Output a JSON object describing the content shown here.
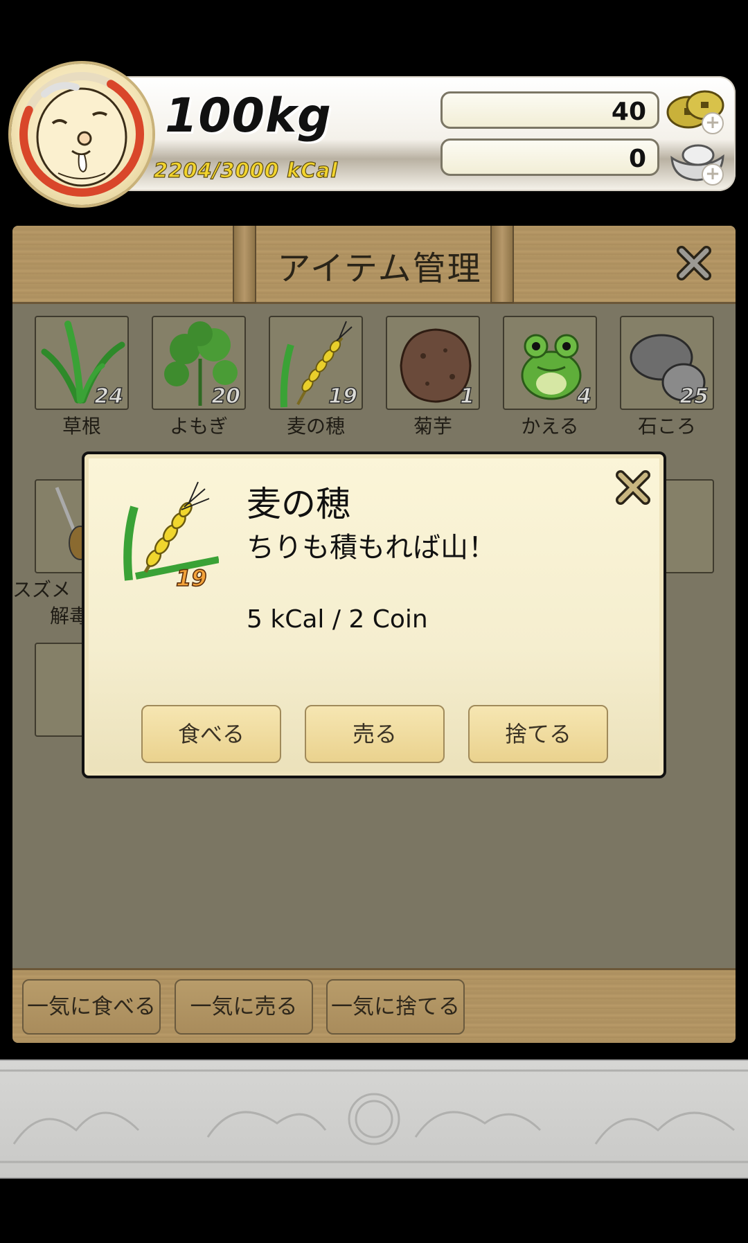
{
  "status": {
    "weight": "100kg",
    "calories": "2204/3000 kCal",
    "calorie_progress": 0.735,
    "gold_coins": "40",
    "silver_coins": "0"
  },
  "panel": {
    "title": "アイテム管理",
    "items": [
      {
        "name": "草根",
        "count": "24",
        "icon": "grass-root-icon"
      },
      {
        "name": "よもぎ",
        "count": "20",
        "icon": "mugwort-icon"
      },
      {
        "name": "麦の穂",
        "count": "19",
        "icon": "wheat-ear-icon"
      },
      {
        "name": "菊芋",
        "count": "1",
        "icon": "jerusalem-artichoke-icon"
      },
      {
        "name": "かえる",
        "count": "4",
        "icon": "frog-icon"
      },
      {
        "name": "石ころ",
        "count": "25",
        "icon": "pebble-icon"
      }
    ],
    "row2_partial": {
      "label_line1": "スズメ",
      "label_line2": "解毒"
    },
    "bulk_buttons": [
      "一気に食べる",
      "一気に売る",
      "一気に捨てる"
    ]
  },
  "dialog": {
    "item_name": "麦の穂",
    "description": "ちりも積もれば山！",
    "price_info": "5 kCal / 2 Coin",
    "count": "19",
    "buttons": [
      "食べる",
      "売る",
      "捨てる"
    ]
  },
  "colors": {
    "panel_bg": "#7b7663",
    "wood": "#b29563",
    "dialog_bg": "#f5eecf",
    "calorie_ring": "#d9462a"
  }
}
